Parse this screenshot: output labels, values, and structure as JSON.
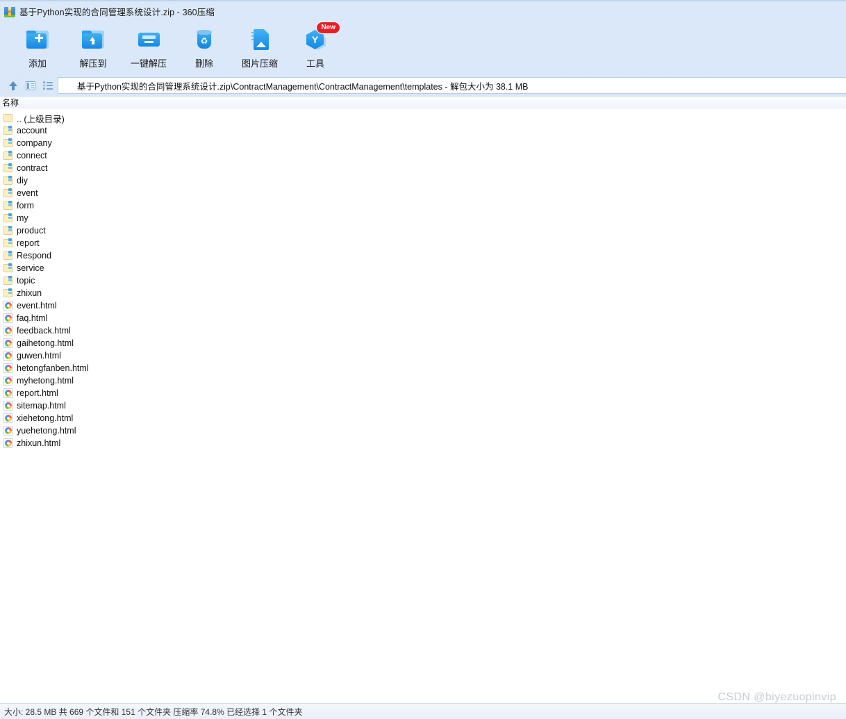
{
  "window": {
    "title": "基于Python实现的合同管理系统设计.zip - 360压缩",
    "app_icon": "zip-archive-icon"
  },
  "toolbar": {
    "buttons": [
      {
        "label": "添加",
        "icon": "add-folder-icon"
      },
      {
        "label": "解压到",
        "icon": "extract-to-folder-icon"
      },
      {
        "label": "一键解压",
        "icon": "one-click-extract-icon"
      },
      {
        "label": "删除",
        "icon": "trash-icon"
      },
      {
        "label": "图片压缩",
        "icon": "image-compress-icon"
      },
      {
        "label": "工具",
        "icon": "tools-hexagon-icon",
        "badge": "New"
      }
    ]
  },
  "navbar": {
    "up_icon": "up-arrow-icon",
    "panel_icon": "preview-panel-icon",
    "list_icon": "list-view-icon",
    "address_icon": "zip-archive-icon",
    "address": "基于Python实现的合同管理系统设计.zip\\ContractManagement\\ContractManagement\\templates - 解包大小为 38.1 MB"
  },
  "list": {
    "column_header": "名称",
    "rows": [
      {
        "name": ".. (上级目录)",
        "type": "parent"
      },
      {
        "name": "account",
        "type": "folder"
      },
      {
        "name": "company",
        "type": "folder"
      },
      {
        "name": "connect",
        "type": "folder"
      },
      {
        "name": "contract",
        "type": "folder"
      },
      {
        "name": "diy",
        "type": "folder"
      },
      {
        "name": "event",
        "type": "folder"
      },
      {
        "name": "form",
        "type": "folder"
      },
      {
        "name": "my",
        "type": "folder"
      },
      {
        "name": "product",
        "type": "folder"
      },
      {
        "name": "report",
        "type": "folder"
      },
      {
        "name": "Respond",
        "type": "folder"
      },
      {
        "name": "service",
        "type": "folder"
      },
      {
        "name": "topic",
        "type": "folder"
      },
      {
        "name": "zhixun",
        "type": "folder"
      },
      {
        "name": "event.html",
        "type": "html"
      },
      {
        "name": "faq.html",
        "type": "html"
      },
      {
        "name": "feedback.html",
        "type": "html"
      },
      {
        "name": "gaihetong.html",
        "type": "html"
      },
      {
        "name": "guwen.html",
        "type": "html"
      },
      {
        "name": "hetongfanben.html",
        "type": "html"
      },
      {
        "name": "myhetong.html",
        "type": "html"
      },
      {
        "name": "report.html",
        "type": "html"
      },
      {
        "name": "sitemap.html",
        "type": "html"
      },
      {
        "name": "xiehetong.html",
        "type": "html"
      },
      {
        "name": "yuehetong.html",
        "type": "html"
      },
      {
        "name": "zhixun.html",
        "type": "html"
      }
    ]
  },
  "statusbar": {
    "text": "大小: 28.5 MB 共 669 个文件和 151 个文件夹 压缩率 74.8% 已经选择 1 个文件夹"
  },
  "watermark": {
    "text": "CSDN @biyezuopinvip"
  },
  "colors": {
    "accent": "#1588e6",
    "chrome": "#d2e2f6",
    "badge": "#ea1c26",
    "folder": "#fcefc0"
  }
}
